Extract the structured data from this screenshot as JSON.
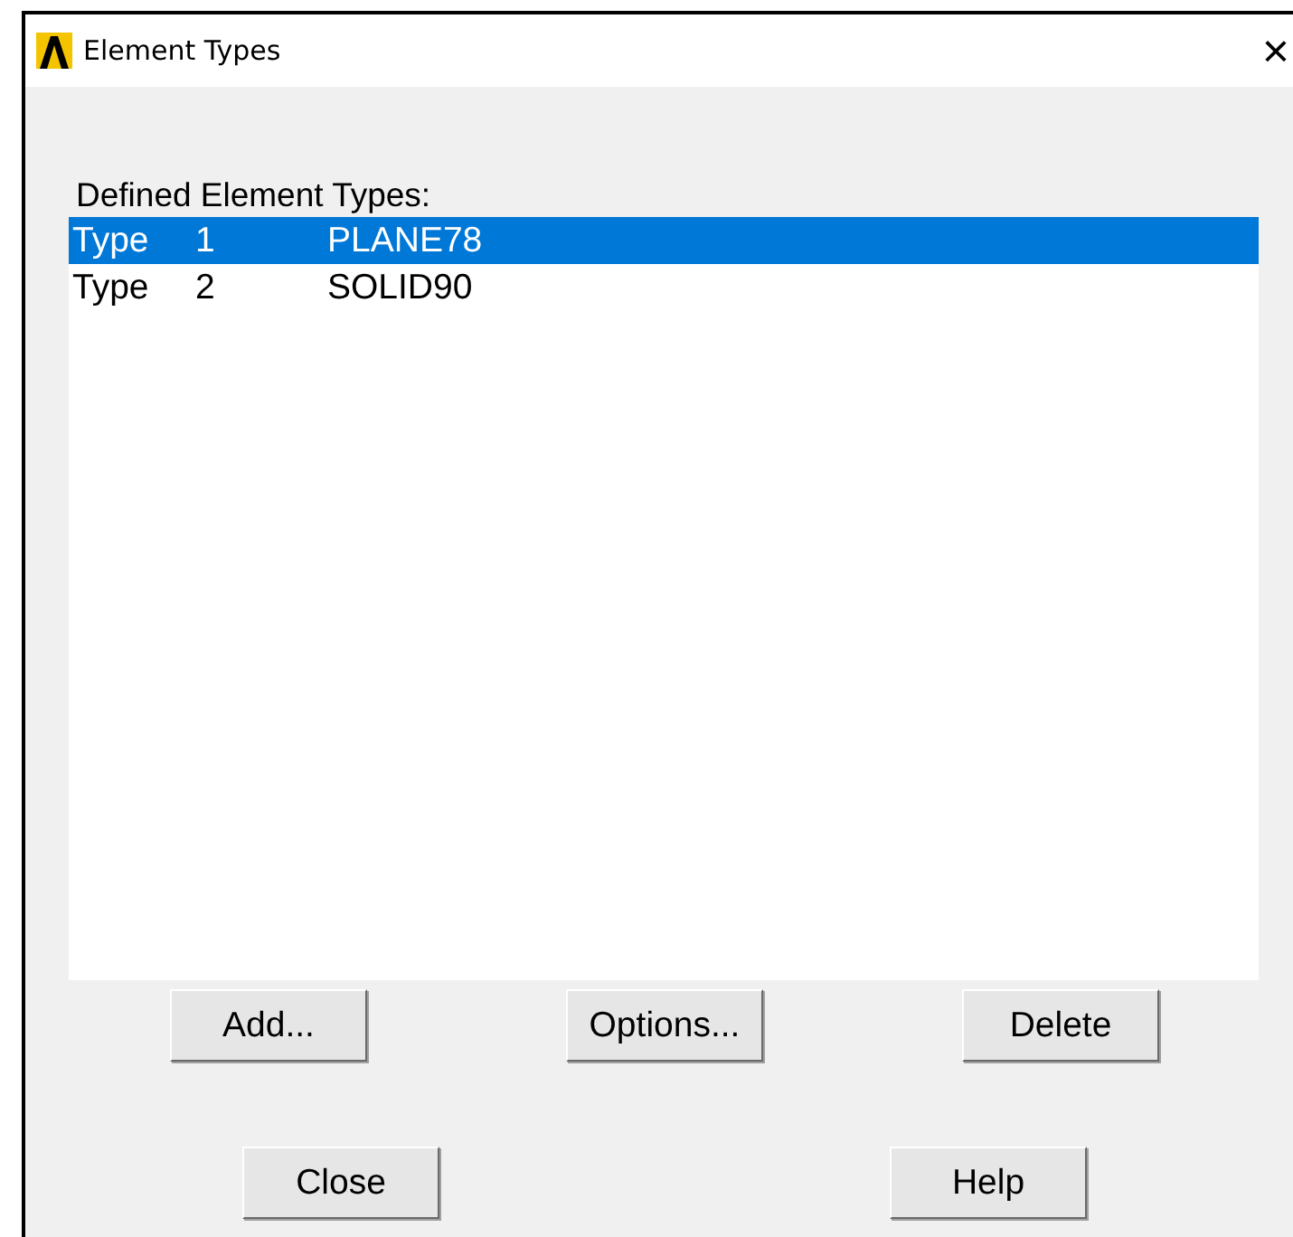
{
  "window": {
    "title": "Element Types",
    "close": "×"
  },
  "list": {
    "label": "Defined Element Types:",
    "rows": [
      {
        "type": "Type",
        "number": "1",
        "name": "PLANE78",
        "selected": true
      },
      {
        "type": "Type",
        "number": "2",
        "name": "SOLID90",
        "selected": false
      }
    ]
  },
  "buttons": [
    "Add...",
    "Options...",
    "Delete"
  ],
  "bottom_buttons": [
    "Close",
    "Help"
  ]
}
